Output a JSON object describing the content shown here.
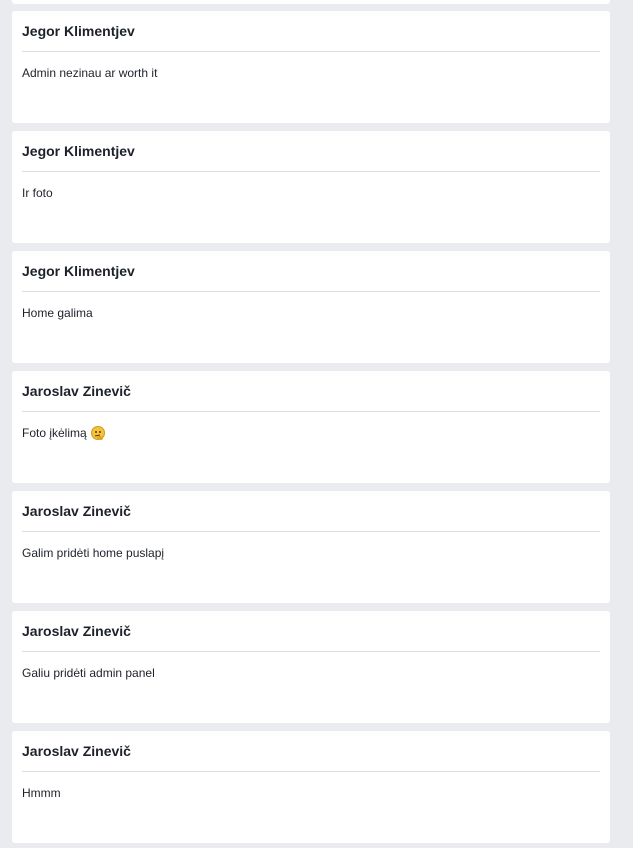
{
  "posts": [
    {
      "author": "Jegor Klimentjev",
      "text": "Admin nezinau ar worth it"
    },
    {
      "author": "Jegor Klimentjev",
      "text": "Ir foto"
    },
    {
      "author": "Jegor Klimentjev",
      "text": "Home galima"
    },
    {
      "author": "Jaroslav Zinevič",
      "text": "Foto įkėlimą",
      "emoji": "thinking-face-icon"
    },
    {
      "author": "Jaroslav Zinevič",
      "text": "Galim pridėti home puslapį"
    },
    {
      "author": "Jaroslav Zinevič",
      "text": "Galiu pridėti admin panel"
    },
    {
      "author": "Jaroslav Zinevič",
      "text": "Hmmm"
    }
  ],
  "colors": {
    "background": "#e9ebee",
    "card": "#ffffff",
    "text": "#1d2129",
    "divider": "#dddfe2"
  }
}
